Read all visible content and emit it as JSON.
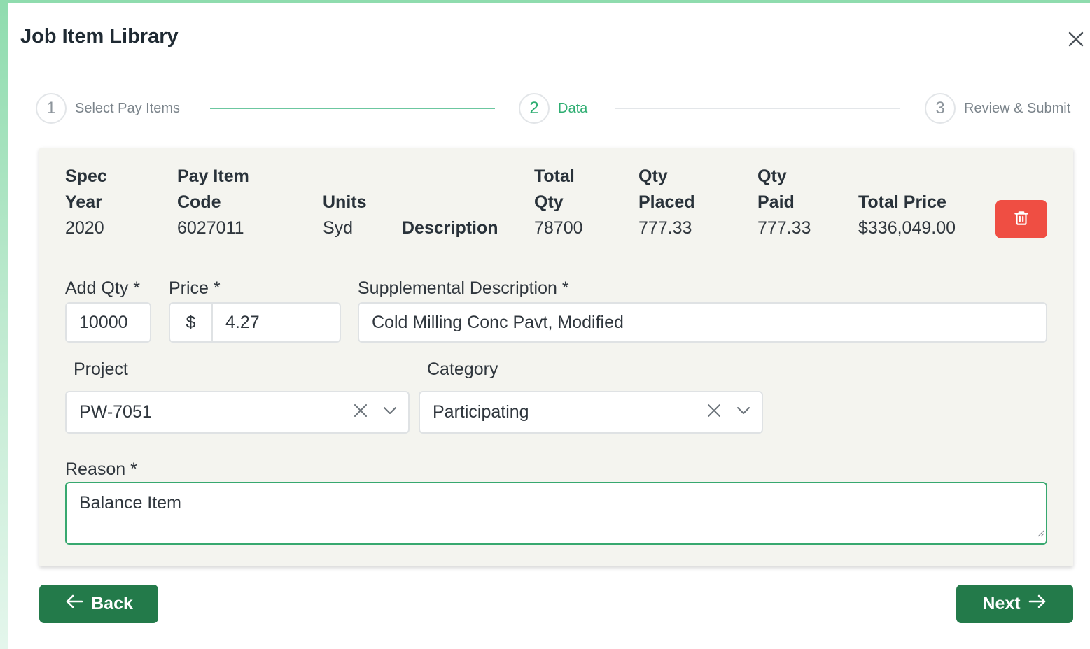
{
  "title": "Job Item Library",
  "stepper": {
    "steps": [
      {
        "number": "1",
        "label": "Select Pay Items",
        "state": "complete"
      },
      {
        "number": "2",
        "label": "Data",
        "state": "active"
      },
      {
        "number": "3",
        "label": "Review & Submit",
        "state": "pending"
      }
    ]
  },
  "item": {
    "headers": {
      "spec_year_1": "Spec",
      "spec_year_2": "Year",
      "pay_item_code_1": "Pay Item",
      "pay_item_code_2": "Code",
      "units": "Units",
      "description": "Description",
      "total_qty_1": "Total",
      "total_qty_2": "Qty",
      "qty_placed_1": "Qty",
      "qty_placed_2": "Placed",
      "qty_paid_1": "Qty",
      "qty_paid_2": "Paid",
      "total_price": "Total Price"
    },
    "values": {
      "spec_year": "2020",
      "pay_item_code": "6027011",
      "units": "Syd",
      "total_qty": "78700",
      "qty_placed": "777.33",
      "qty_paid": "777.33",
      "total_price": "$336,049.00"
    }
  },
  "form": {
    "add_qty_label": "Add Qty *",
    "add_qty_value": "10000",
    "price_label": "Price *",
    "price_prefix": "$",
    "price_value": "4.27",
    "supp_desc_label": "Supplemental Description *",
    "supp_desc_value": "Cold Milling Conc Pavt, Modified",
    "project_label": "Project",
    "project_value": "PW-7051",
    "category_label": "Category",
    "category_value": "Participating",
    "reason_label": "Reason *",
    "reason_value": "Balance Item"
  },
  "footer": {
    "back_label": "Back",
    "next_label": "Next"
  },
  "colors": {
    "accent": "#2fae72",
    "button": "#237a4a",
    "danger": "#ef4e43"
  }
}
